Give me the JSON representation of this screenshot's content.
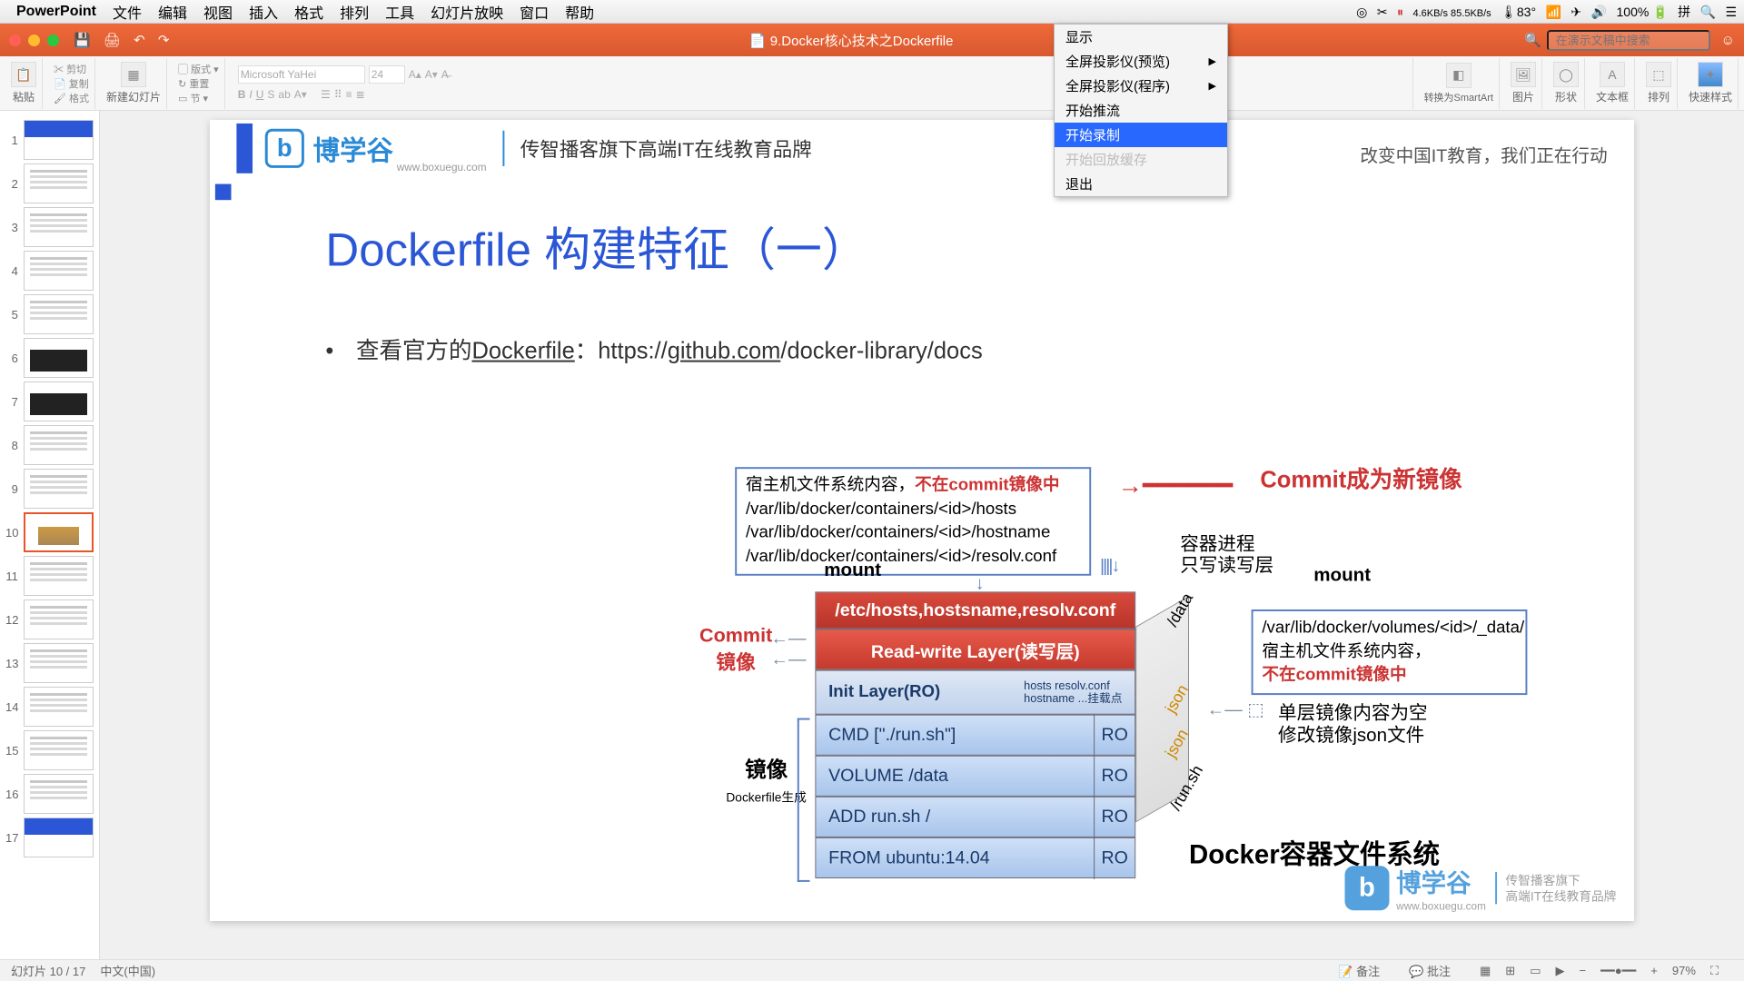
{
  "menubar": {
    "app": "PowerPoint",
    "items": [
      "文件",
      "编辑",
      "视图",
      "插入",
      "格式",
      "排列",
      "工具",
      "幻灯片放映",
      "窗口",
      "帮助"
    ],
    "right": [
      "✂",
      "⏸",
      "▬",
      "📊",
      "83°",
      "⬆",
      "✈",
      "〈 〉",
      "🔊",
      "100%",
      "🔋",
      "📶",
      "搜狗拼音",
      "⏰",
      "☰",
      "≡"
    ],
    "stats": "4.6KB/s 85.5KB/s"
  },
  "titlebar": {
    "doc": "9.Docker核心技术之Dockerfile",
    "search_ph": "在演示文稿中搜索"
  },
  "ribbon": {
    "paste": "粘贴",
    "cut": "剪切",
    "copy": "复制",
    "format": "格式",
    "newslide": "新建幻灯片",
    "layout": "版式",
    "reset": "重置",
    "section": "节",
    "font": "Microsoft YaHei",
    "size": "24",
    "smartart": "转换为SmartArt",
    "picture": "图片",
    "shape": "形状",
    "textbox": "文本框",
    "arrange": "排列",
    "quickstyle": "快速样式"
  },
  "ctx": {
    "i0": "显示",
    "i1": "全屏投影仪(预览)",
    "i2": "全屏投影仪(程序)",
    "i3": "开始推流",
    "i4": "开始录制",
    "i5": "开始回放缓存",
    "i6": "退出"
  },
  "thumbs": [
    "1",
    "2",
    "3",
    "4",
    "5",
    "6",
    "7",
    "8",
    "9",
    "10",
    "11",
    "12",
    "13",
    "14",
    "15",
    "16",
    "17"
  ],
  "slide": {
    "brand": "博学谷",
    "brand_sub": "www.boxuegu.com",
    "tagline": "传智播客旗下高端IT在线教育品牌",
    "tagline_r": "改变中国IT教育，我们正在行动",
    "title": "Dockerfile 构建特征（一）",
    "bullet_pre": "查看官方的",
    "bullet_link": "Dockerfile",
    "bullet_mid": "：https://",
    "bullet_link2": "github.com",
    "bullet_post": "/docker-library/docs",
    "box1_a": "宿主机文件系统内容，",
    "box1_b": "不在commit镜像中",
    "box1_l1": "/var/lib/docker/containers/<id>/hosts",
    "box1_l2": "/var/lib/docker/containers/<id>/hostname",
    "box1_l3": "/var/lib/docker/containers/<id>/resolv.conf",
    "mount": "mount",
    "mount2": "mount",
    "commit_title": "Commit成为新镜像",
    "proc1": "容器进程",
    "proc2": "只写读写层",
    "layer_etc": "/etc/hosts,hostsname,resolv.conf",
    "layer_rw": "Read-write Layer(读写层)",
    "layer_init": "Init Layer(RO)",
    "init_s1": "hosts    resolv.conf",
    "init_s2": "hostname ...挂载点",
    "layer_cmd": "CMD [\"./run.sh\"]",
    "layer_vol": "VOLUME /data",
    "layer_add": "ADD run.sh /",
    "layer_from": "FROM ubuntu:14.04",
    "ro": "RO",
    "commit_side": "Commit",
    "mirror_side": "镜像",
    "img_lbl": "镜像",
    "img_sub": "Dockerfile生成",
    "vol_path": "/var/lib/docker/volumes/<id>/_data/",
    "vol_t1": "宿主机文件系统内容，",
    "vol_t2": "不在commit镜像中",
    "json_t1": "单层镜像内容为空",
    "json_t2": "修改镜像json文件",
    "side_data": "/data",
    "side_json": "json",
    "side_json2": "json",
    "side_run": "/run.sh",
    "fs_title": "Docker容器文件系统",
    "footer_brand": "博学谷",
    "footer_t1": "传智播客旗下",
    "footer_t2": "高端IT在线教育品牌",
    "footer_url": "www.boxuegu.com"
  },
  "status": {
    "slide": "幻灯片 10 / 17",
    "lang": "中文(中国)",
    "notes": "备注",
    "comments": "批注",
    "zoom": "97%"
  }
}
